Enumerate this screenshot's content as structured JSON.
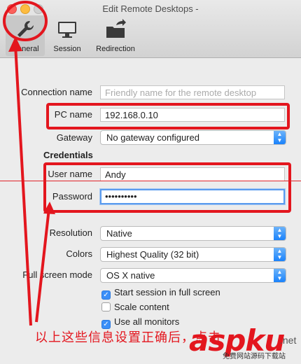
{
  "window": {
    "title": "Edit Remote Desktops -"
  },
  "toolbar": {
    "tabs": [
      {
        "label": "General",
        "icon": "wrench-icon"
      },
      {
        "label": "Session",
        "icon": "monitor-icon"
      },
      {
        "label": "Redirection",
        "icon": "folder-arrow-icon"
      }
    ]
  },
  "form": {
    "connection_name": {
      "label": "Connection name",
      "placeholder": "Friendly name for the remote desktop",
      "value": ""
    },
    "pc_name": {
      "label": "PC name",
      "value": "192.168.0.10"
    },
    "gateway": {
      "label": "Gateway",
      "value": "No gateway configured"
    },
    "credentials_heading": "Credentials",
    "user_name": {
      "label": "User name",
      "value": "Andy"
    },
    "password": {
      "label": "Password",
      "value": "••••••••••"
    },
    "resolution": {
      "label": "Resolution",
      "value": "Native"
    },
    "colors": {
      "label": "Colors",
      "value": "Highest Quality (32 bit)"
    },
    "full_screen_mode": {
      "label": "Full screen mode",
      "value": "OS X native"
    },
    "checkboxes": [
      {
        "label": "Start session in full screen",
        "checked": true
      },
      {
        "label": "Scale content",
        "checked": false
      },
      {
        "label": "Use all monitors",
        "checked": true
      }
    ]
  },
  "annotation": {
    "caption": "以上这些信息设置正确后，点击",
    "color": "#e3161e"
  },
  "watermark": {
    "brand": "aspku",
    "tld": ".net",
    "sub": "免费网站源码下载站"
  }
}
